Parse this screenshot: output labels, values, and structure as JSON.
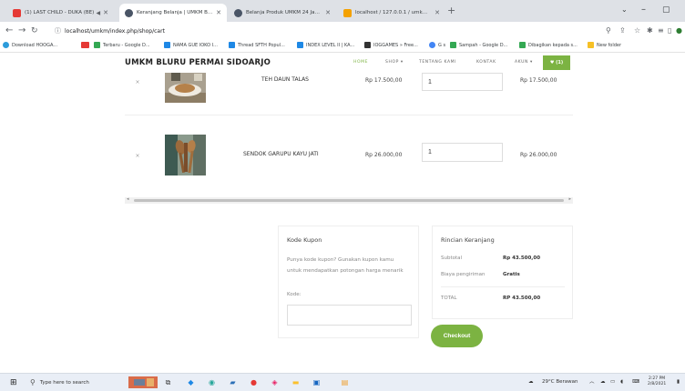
{
  "browser": {
    "tabs": [
      {
        "title": "(1) LAST CHILD - DUKA (BE)",
        "color": "#e53935",
        "icon": "youtube-icon"
      },
      {
        "title": "Keranjang Belanja | UMKM Bluru",
        "color": "#4a5566",
        "icon": "globe-icon",
        "active": true
      },
      {
        "title": "Belanja Produk UMKM 24 Jam |",
        "color": "#4a5566",
        "icon": "globe-icon"
      },
      {
        "title": "localhost / 127.0.0.1 / umkm / p",
        "color": "#f4a100",
        "icon": "phpmyadmin-icon"
      }
    ],
    "url": "localhost/umkm/index.php/shop/cart",
    "bookmarks": [
      {
        "label": "Download HOOGA...",
        "color": "#2d9cdb"
      },
      {
        "label": "",
        "color": "#e53935"
      },
      {
        "label": "Terbaru - Google D...",
        "color": "#34a853"
      },
      {
        "label": "NAMA GUE IOKO I...",
        "color": "#1e88e5"
      },
      {
        "label": "Thread SFTH Popul...",
        "color": "#1e88e5"
      },
      {
        "label": "INDEX LEVEL II | KA...",
        "color": "#1e88e5"
      },
      {
        "label": "IOGGAMES » Free...",
        "color": "#333333"
      },
      {
        "label": "G  s",
        "color": "#4285f4"
      },
      {
        "label": "Sampah - Google D...",
        "color": "#34a853"
      },
      {
        "label": "Dibagikan kepada s...",
        "color": "#34a853"
      },
      {
        "label": "New folder",
        "color": "#f6c026"
      }
    ]
  },
  "site": {
    "brand": "UMKM BLURU PERMAI SIDOARJO",
    "menu": [
      "HOME",
      "SHOP ▾",
      "TENTANG KAMI",
      "KONTAK",
      "AKUN ▾"
    ],
    "cart_label": "♥ (1)",
    "accent": "#7cb342"
  },
  "cart": {
    "items": [
      {
        "name": "TEH DAUN TALAS",
        "price": "Rp 17.500,00",
        "qty": "1",
        "subtotal": "Rp 17.500,00",
        "remove": "×"
      },
      {
        "name": "SENDOK GARUPU KAYU JATI",
        "price": "Rp 26.000,00",
        "qty": "1",
        "subtotal": "Rp 26.000,00",
        "remove": "×"
      }
    ]
  },
  "coupon": {
    "title": "Kode Kupon",
    "text": "Punya kode kupon? Gunakan kupon kamu untuk mendapatkan potongan harga menarik",
    "label": "Kode:",
    "value": ""
  },
  "totals": {
    "title": "Rincian Keranjang",
    "rows": [
      {
        "label": "Subtotal",
        "value": "Rp 43.500,00"
      },
      {
        "label": "Biaya pengiriman",
        "value": "Gratis"
      },
      {
        "label": "TOTAL",
        "value": "RP 43.500,00"
      }
    ],
    "checkout_label": "Checkout"
  },
  "taskbar": {
    "search_placeholder": "Type here to search",
    "weather": "29°C  Berawan",
    "time": "2:27 PM",
    "date": "2/8/2021"
  }
}
